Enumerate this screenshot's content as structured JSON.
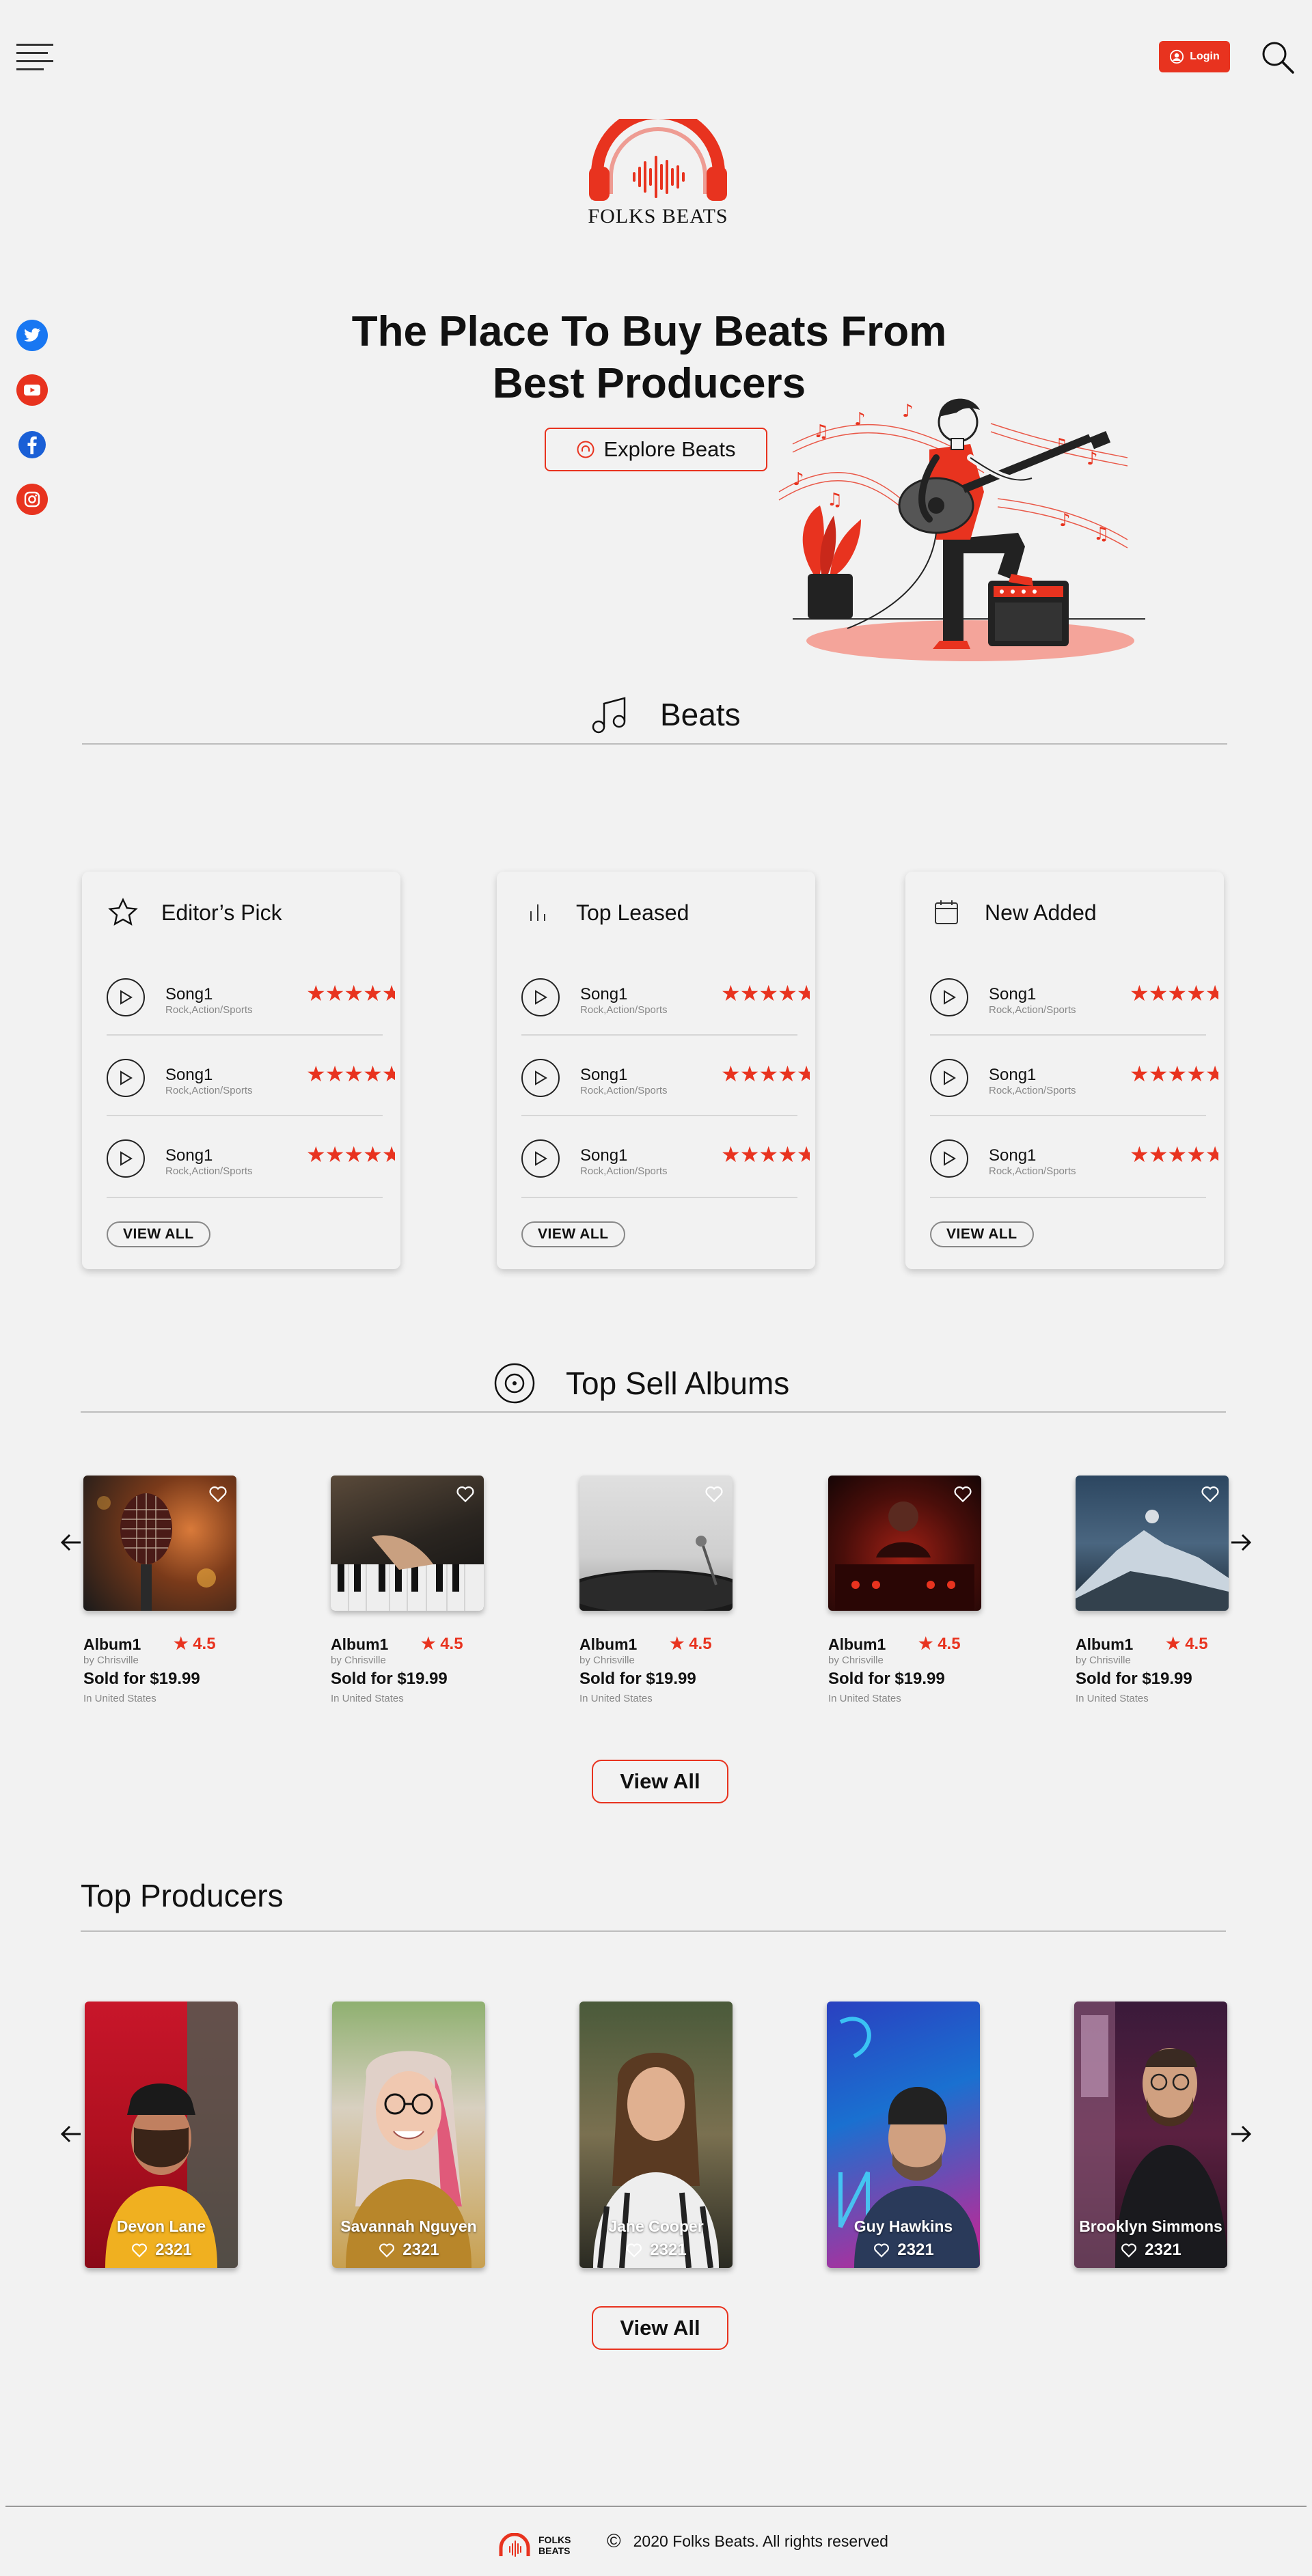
{
  "header": {
    "login_label": "Login"
  },
  "brand": {
    "name": "FOLKS BEATS",
    "footer_name_line1": "FOLKS",
    "footer_name_line2": "BEATS",
    "accent_color": "#e8331f"
  },
  "social": [
    "twitter-icon",
    "youtube-icon",
    "facebook-icon",
    "instagram-icon"
  ],
  "hero": {
    "title_line1": "The Place To Buy Beats From",
    "title_line2": "Best Producers",
    "cta_label": "Explore Beats"
  },
  "beats_section": {
    "title": "Beats",
    "cards": [
      {
        "title": "Editor’s Pick",
        "icon": "star-icon",
        "songs": [
          {
            "name": "Song1",
            "genre": "Rock,Action/Sports",
            "rating": 5
          },
          {
            "name": "Song1",
            "genre": "Rock,Action/Sports",
            "rating": 5
          },
          {
            "name": "Song1",
            "genre": "Rock,Action/Sports",
            "rating": 5
          }
        ],
        "view_all": "VIEW ALL"
      },
      {
        "title": "Top Leased",
        "icon": "bars-icon",
        "songs": [
          {
            "name": "Song1",
            "genre": "Rock,Action/Sports",
            "rating": 5
          },
          {
            "name": "Song1",
            "genre": "Rock,Action/Sports",
            "rating": 5
          },
          {
            "name": "Song1",
            "genre": "Rock,Action/Sports",
            "rating": 5
          }
        ],
        "view_all": "VIEW ALL"
      },
      {
        "title": "New Added",
        "icon": "calendar-icon",
        "songs": [
          {
            "name": "Song1",
            "genre": "Rock,Action/Sports",
            "rating": 5
          },
          {
            "name": "Song1",
            "genre": "Rock,Action/Sports",
            "rating": 5
          },
          {
            "name": "Song1",
            "genre": "Rock,Action/Sports",
            "rating": 5
          }
        ],
        "view_all": "VIEW ALL"
      }
    ]
  },
  "albums_section": {
    "title": "Top Sell Albums",
    "albums": [
      {
        "name": "Album1",
        "rating": "4.5",
        "by": "by Chrisville",
        "price": "Sold for $19.99",
        "location": "In United States",
        "image": "microphone"
      },
      {
        "name": "Album1",
        "rating": "4.5",
        "by": "by Chrisville",
        "price": "Sold for $19.99",
        "location": "In United States",
        "image": "piano"
      },
      {
        "name": "Album1",
        "rating": "4.5",
        "by": "by Chrisville",
        "price": "Sold for $19.99",
        "location": "In United States",
        "image": "turntable"
      },
      {
        "name": "Album1",
        "rating": "4.5",
        "by": "by Chrisville",
        "price": "Sold for $19.99",
        "location": "In United States",
        "image": "dj-booth"
      },
      {
        "name": "Album1",
        "rating": "4.5",
        "by": "by Chrisville",
        "price": "Sold for $19.99",
        "location": "In United States",
        "image": "mountain"
      }
    ],
    "view_all": "View All"
  },
  "producers_section": {
    "title": "Top Producers",
    "producers": [
      {
        "name": "Devon Lane",
        "likes": "2321"
      },
      {
        "name": "Savannah Nguyen",
        "likes": "2321"
      },
      {
        "name": "Jane Cooper",
        "likes": "2321"
      },
      {
        "name": "Guy Hawkins",
        "likes": "2321"
      },
      {
        "name": "Brooklyn Simmons",
        "likes": "2321"
      }
    ],
    "view_all": "View All"
  },
  "footer": {
    "copyright_symbol": "©",
    "copyright": "2020 Folks Beats. All rights reserved"
  }
}
